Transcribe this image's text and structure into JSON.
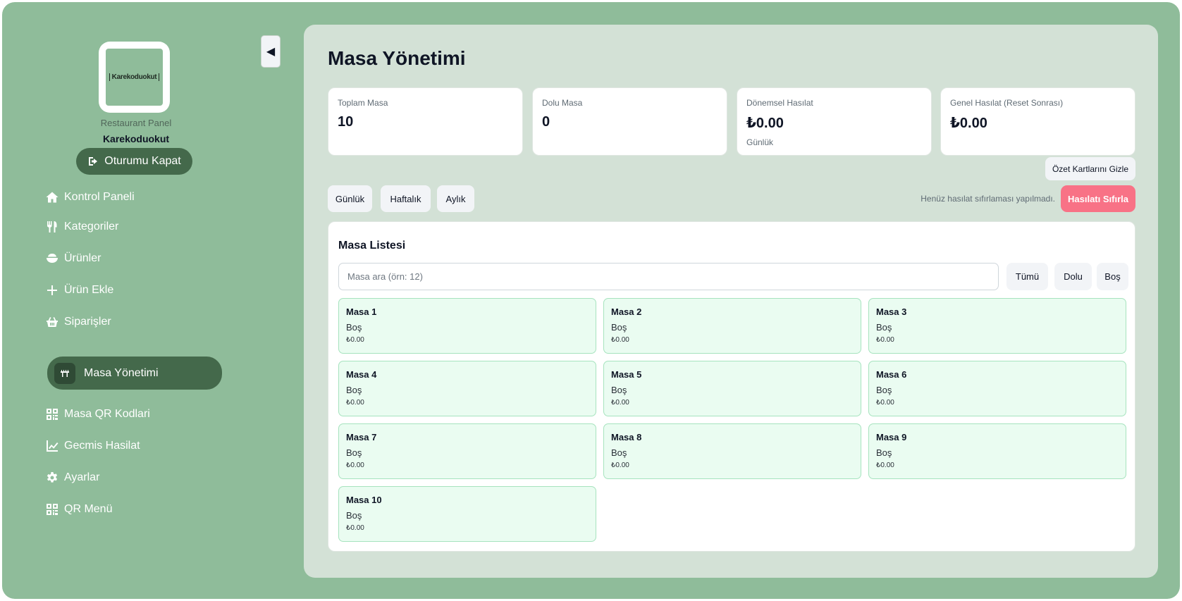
{
  "sidebar": {
    "logo_text": "Karekoduokut",
    "panel_label": "Restaurant Panel",
    "restaurant_name": "Karekoduokut",
    "logout_label": "Oturumu Kapat",
    "items": [
      {
        "label": "Kontrol Paneli",
        "icon": "home-icon"
      },
      {
        "label": "Kategoriler",
        "icon": "utensils-icon"
      },
      {
        "label": "Ürünler",
        "icon": "bowl-icon"
      },
      {
        "label": "Ürün Ekle",
        "icon": "plus-icon"
      },
      {
        "label": "Siparişler",
        "icon": "basket-icon"
      },
      {
        "label": "Masa Yönetimi",
        "icon": "table-icon",
        "active": true
      },
      {
        "label": "Masa QR Kodlari",
        "icon": "qr-icon"
      },
      {
        "label": "Gecmis Hasilat",
        "icon": "chart-line-icon"
      },
      {
        "label": "Ayarlar",
        "icon": "gear-icon"
      },
      {
        "label": "QR Menü",
        "icon": "qr-icon"
      }
    ],
    "collapse_glyph": "◀"
  },
  "main": {
    "title": "Masa Yönetimi",
    "stats": [
      {
        "label": "Toplam Masa",
        "value": "10",
        "sub": ""
      },
      {
        "label": "Dolu Masa",
        "value": "0",
        "sub": ""
      },
      {
        "label": "Dönemsel Hasılat",
        "value": "₺0.00",
        "sub": "Günlük"
      },
      {
        "label": "Genel Hasılat (Reset Sonrası)",
        "value": "₺0.00",
        "sub": ""
      }
    ],
    "hide_cards_label": "Özet Kartlarını Gizle",
    "periods": [
      "Günlük",
      "Haftalık",
      "Aylık"
    ],
    "reset_note": "Henüz hasılat sıfırlaması yapılmadı.",
    "reset_label": "Hasılatı Sıfırla",
    "list": {
      "title": "Masa Listesi",
      "search_placeholder": "Masa ara (örn: 12)",
      "filters": [
        "Tümü",
        "Dolu",
        "Boş"
      ],
      "tables": [
        {
          "name": "Masa 1",
          "status": "Boş",
          "amount": "₺0.00"
        },
        {
          "name": "Masa 2",
          "status": "Boş",
          "amount": "₺0.00"
        },
        {
          "name": "Masa 3",
          "status": "Boş",
          "amount": "₺0.00"
        },
        {
          "name": "Masa 4",
          "status": "Boş",
          "amount": "₺0.00"
        },
        {
          "name": "Masa 5",
          "status": "Boş",
          "amount": "₺0.00"
        },
        {
          "name": "Masa 6",
          "status": "Boş",
          "amount": "₺0.00"
        },
        {
          "name": "Masa 7",
          "status": "Boş",
          "amount": "₺0.00"
        },
        {
          "name": "Masa 8",
          "status": "Boş",
          "amount": "₺0.00"
        },
        {
          "name": "Masa 9",
          "status": "Boş",
          "amount": "₺0.00"
        },
        {
          "name": "Masa 10",
          "status": "Boş",
          "amount": "₺0.00"
        }
      ]
    }
  },
  "colors": {
    "background": "#8fbc9a",
    "main_panel": "#d3e1d6",
    "accent_dark": "#44694b",
    "danger": "#f87286",
    "table_card": "#eafcf1",
    "table_border": "#a6e3be"
  }
}
